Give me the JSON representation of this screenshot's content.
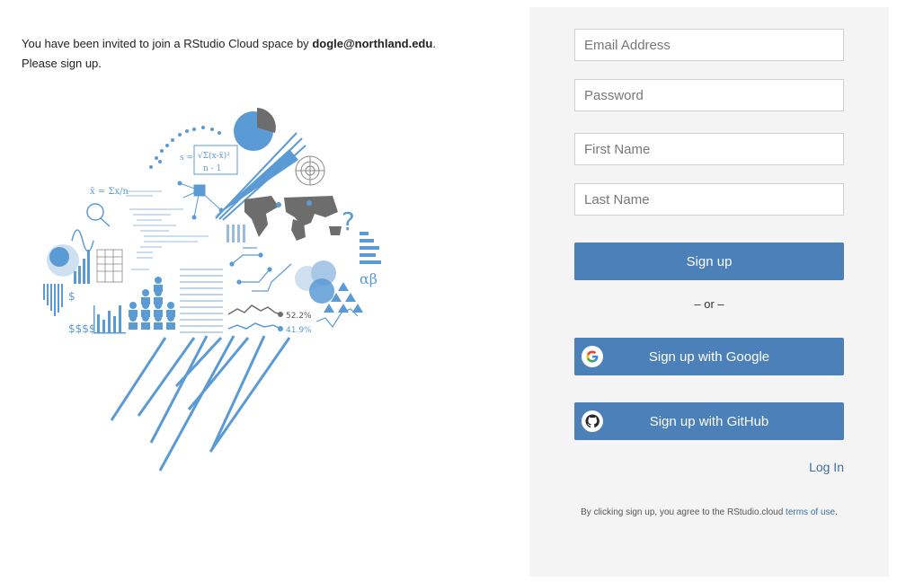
{
  "invite": {
    "prefix": "You have been invited to join a RStudio Cloud space by ",
    "email": "dogle@northland.edu",
    "suffix": ".",
    "line2": "Please sign up."
  },
  "illustration": {
    "pct1": "52.2%",
    "pct2": "41.9%",
    "alpha_beta": "αβ",
    "question": "?"
  },
  "form": {
    "email_placeholder": "Email Address",
    "password_placeholder": "Password",
    "first_name_placeholder": "First Name",
    "last_name_placeholder": "Last Name",
    "signup_label": "Sign up",
    "or_label": "– or –",
    "google_label": "Sign up with Google",
    "github_label": "Sign up with GitHub",
    "login_label": "Log In",
    "terms_prefix": "By clicking sign up, you agree to the RStudio.cloud ",
    "terms_link": "terms of use",
    "terms_suffix": "."
  },
  "colors": {
    "accent": "#4b81b8",
    "panel_bg": "#f4f4f4",
    "illustration_blue": "#5b9bd5",
    "illustration_gray": "#6d6d6d"
  },
  "icons": [
    "google-icon",
    "github-icon"
  ]
}
